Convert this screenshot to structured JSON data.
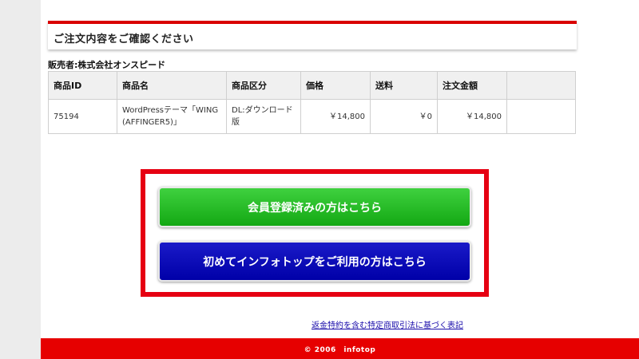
{
  "order": {
    "header_title": "ご注文内容をご確認ください",
    "seller_label": "販売者:株式会社オンスピード",
    "columns": [
      "商品ID",
      "商品名",
      "商品区分",
      "価格",
      "送料",
      "注文金額",
      ""
    ],
    "rows": [
      {
        "id": "75194",
        "name_line1": "WordPressテーマ「WING",
        "name_line2": "(AFFINGER5)」",
        "category_line1": "DL:ダウンロード",
        "category_line2": "版",
        "price": "￥14,800",
        "shipping": "￥0",
        "total": "￥14,800",
        "extra": ""
      }
    ]
  },
  "cta": {
    "member_label": "会員登録済みの方はこちら",
    "first_time_label": "初めてインフォトップをご利用の方はこちら",
    "member_color": "#1fb41f",
    "first_time_color": "#0000b0",
    "frame_color": "#e60012"
  },
  "legal_link": "返金特約を含む特定商取引法に基づく表記",
  "footer": {
    "text": "© 2006　infotop",
    "color": "#e60000"
  }
}
